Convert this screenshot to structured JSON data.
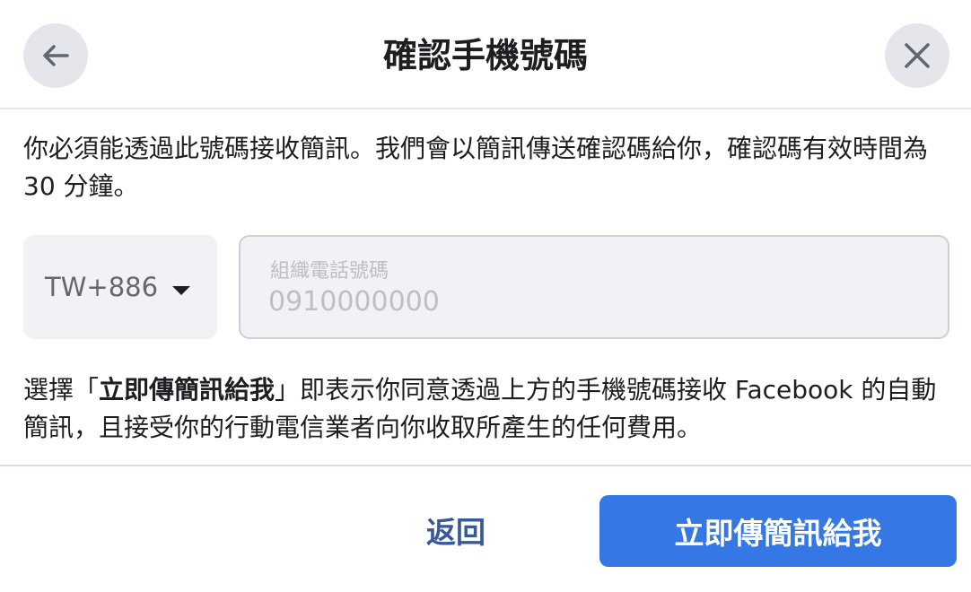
{
  "header": {
    "title": "確認手機號碼",
    "back_icon": "arrow-left-icon",
    "close_icon": "close-icon"
  },
  "description": "你必須能透過此號碼接收簡訊。我們會以簡訊傳送確認碼給你，確認碼有效時間為 30 分鐘。",
  "country_selector": {
    "value": "TW+886",
    "icon": "caret-down-icon"
  },
  "phone_field": {
    "label": "組織電話號碼",
    "placeholder": "0910000000",
    "value": ""
  },
  "consent": {
    "prefix": "選擇「",
    "highlight": "立即傳簡訊給我",
    "suffix": "」即表示你同意透過上方的手機號碼接收 Facebook 的自動簡訊，且接受你的行動電信業者向你收取所產生的任何費用。"
  },
  "footer": {
    "back_label": "返回",
    "primary_label": "立即傳簡訊給我"
  },
  "colors": {
    "primary": "#3578e5",
    "link": "#385898",
    "field_bg": "#f0f2f5",
    "icon_button_bg": "#e4e6eb"
  }
}
